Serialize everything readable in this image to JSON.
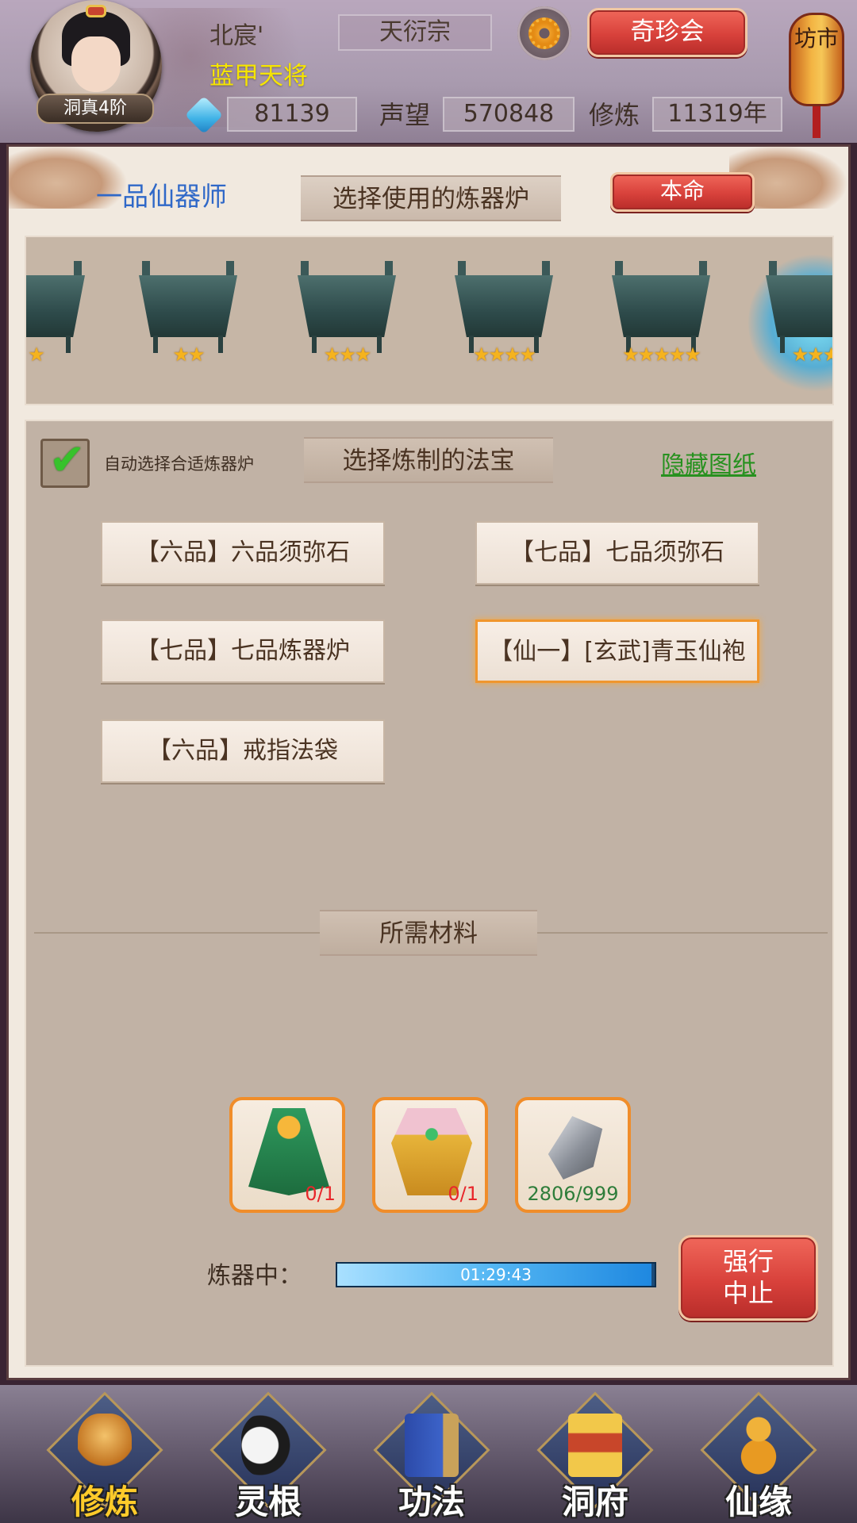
{
  "header": {
    "player_name": "北宸'",
    "player_title": "蓝甲天将",
    "rank": "洞真4阶",
    "sect": "天衍宗",
    "qizhen_label": "奇珍会",
    "market_label": "坊市",
    "spirit_stones": "81139",
    "prestige_label": "声望",
    "prestige": "570848",
    "cultivation_label": "修炼",
    "cultivation": "11319年"
  },
  "forge": {
    "smith_rank": "一品仙器师",
    "select_furnace_title": "选择使用的炼器炉",
    "benming_label": "本命",
    "furnaces": [
      {
        "stars": "★"
      },
      {
        "stars": "★★"
      },
      {
        "stars": "★★★"
      },
      {
        "stars": "★★★★"
      },
      {
        "stars": "★★★★★"
      },
      {
        "stars": "★★★"
      }
    ],
    "auto_select_label": "自动选择合适炼器炉",
    "auto_select_checked": true,
    "select_treasure_title": "选择炼制的法宝",
    "hide_blueprint_label": "隐藏图纸",
    "items": [
      {
        "label": "【六品】六品须弥石",
        "selected": false
      },
      {
        "label": "【七品】七品须弥石",
        "selected": false
      },
      {
        "label": "【七品】七品炼器炉",
        "selected": false
      },
      {
        "label": "【仙一】[玄武]青玉仙袍",
        "selected": true
      },
      {
        "label": "【六品】戒指法袋",
        "selected": false
      }
    ],
    "materials_title": "所需材料",
    "materials": [
      {
        "icon": "green-robe-icon",
        "count": "0/1"
      },
      {
        "icon": "golden-armor-icon",
        "count": "0/1"
      },
      {
        "icon": "iron-ore-icon",
        "count": "2806/999"
      }
    ],
    "progress_label": "炼器中：",
    "progress_time": "01:29:43",
    "progress_fraction": 0.99,
    "stop_label_line1": "强行",
    "stop_label_line2": "中止"
  },
  "nav": {
    "items": [
      {
        "label": "修炼",
        "active": true
      },
      {
        "label": "灵根",
        "active": false
      },
      {
        "label": "功法",
        "active": false
      },
      {
        "label": "洞府",
        "active": false
      },
      {
        "label": "仙缘",
        "active": false
      }
    ]
  }
}
